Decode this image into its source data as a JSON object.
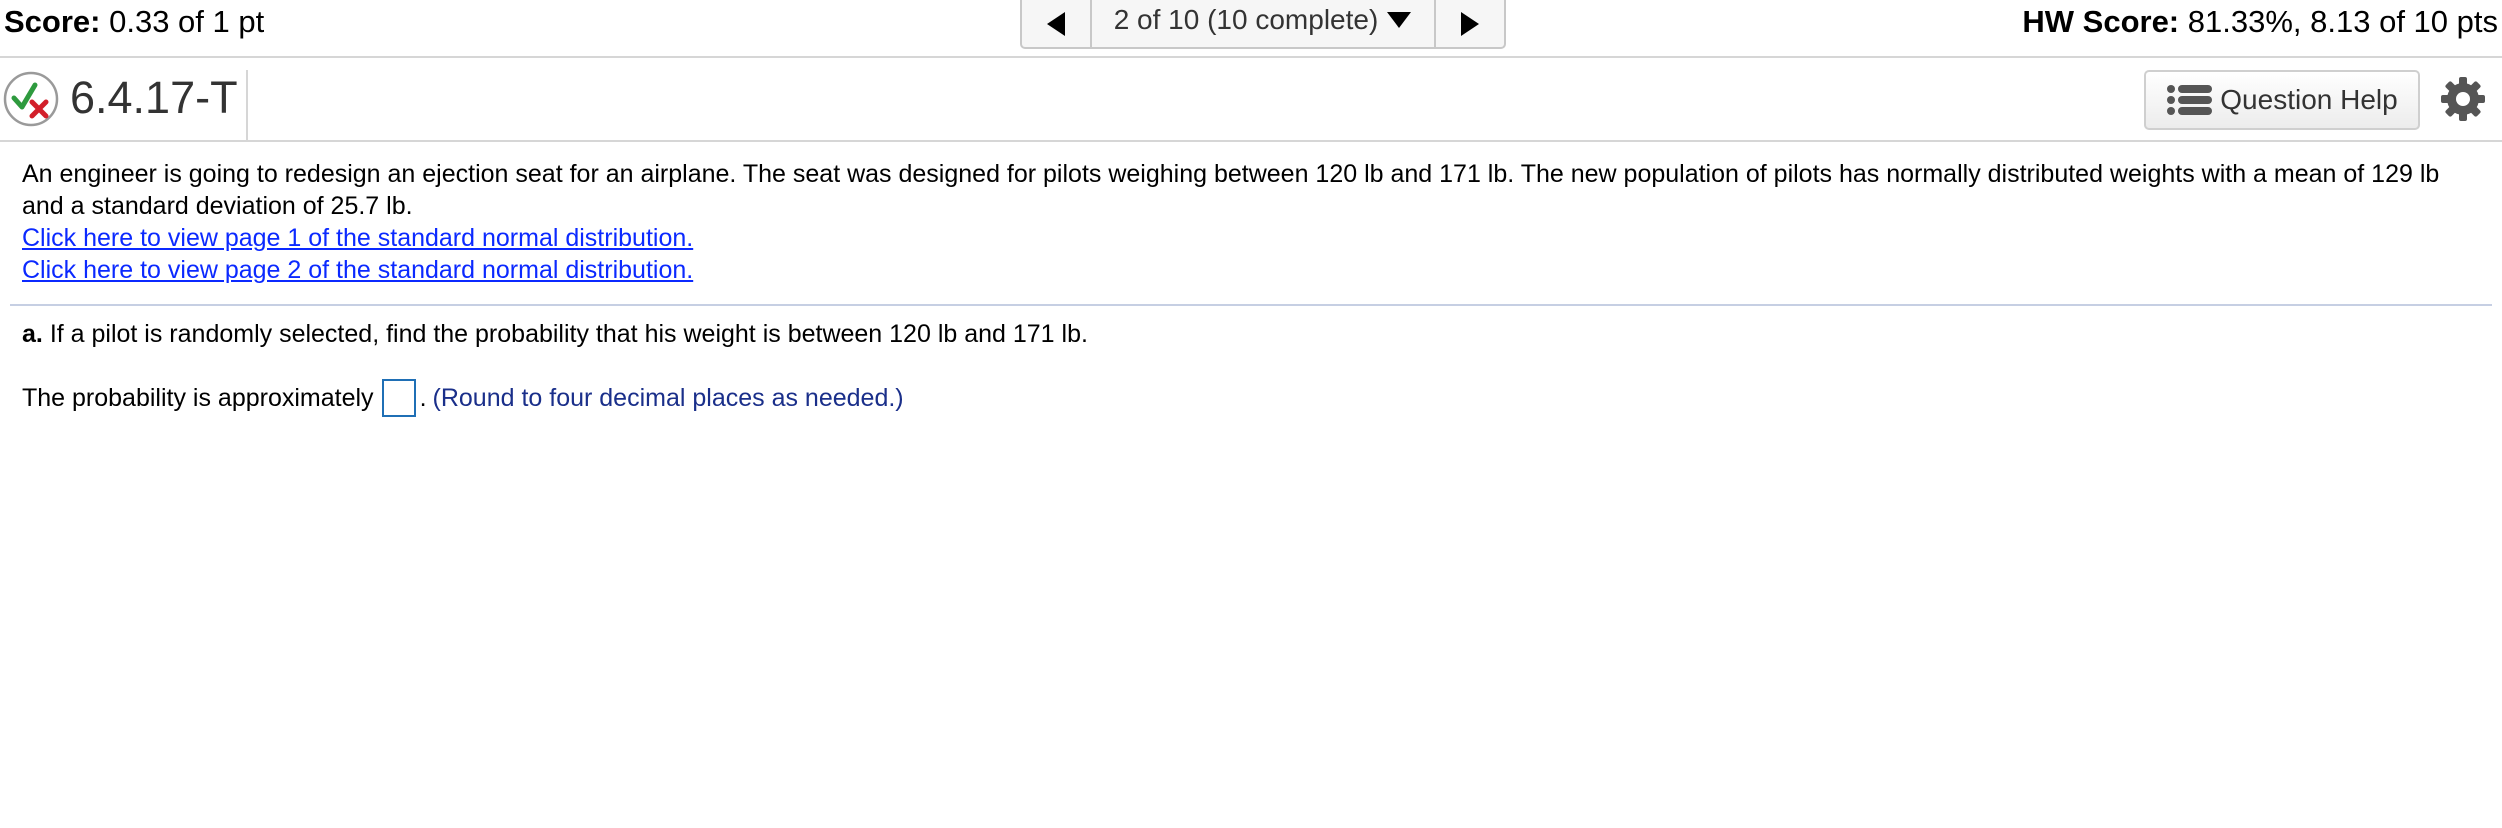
{
  "topbar": {
    "score_label": "Score:",
    "score_value": "0.33 of 1 pt",
    "nav_position": "2 of 10 (10 complete)",
    "hw_score_label": "HW Score:",
    "hw_score_value": "81.33%, 8.13 of 10 pts"
  },
  "question": {
    "number": "6.4.17-T",
    "status": "partially-correct",
    "help_label": "Question Help"
  },
  "problem": {
    "text": "An engineer is going to redesign an ejection seat for an airplane. The seat was designed for pilots weighing between 120 lb and 171 lb. The new population of pilots has normally distributed weights with a mean of 129 lb and a standard deviation of 25.7 lb.",
    "link1": "Click here to view page 1 of the standard normal distribution.",
    "link2": "Click here to view page 2 of the standard normal distribution."
  },
  "part_a": {
    "label": "a.",
    "text": "If a pilot is randomly selected, find the probability that his weight is between 120 lb and 171 lb.",
    "answer_prefix": "The probability is approximately",
    "answer_value": "",
    "answer_suffix": ".",
    "hint": "(Round to four decimal places as needed.)"
  },
  "colors": {
    "link": "#0b29ff",
    "hint": "#1a2f8a",
    "check_green": "#2e9a3e",
    "cross_red": "#d21f2a"
  }
}
